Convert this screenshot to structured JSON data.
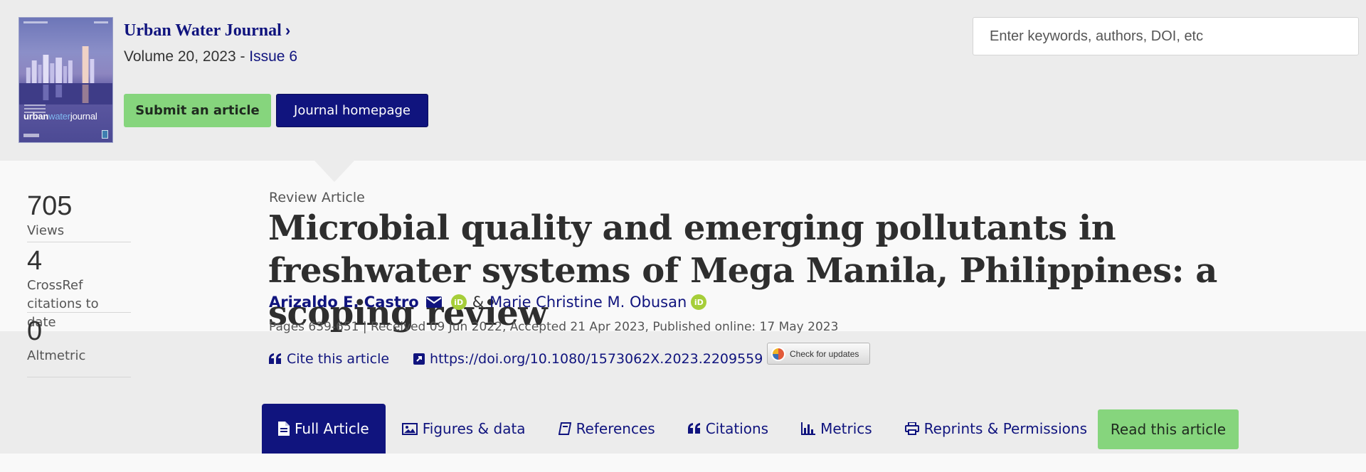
{
  "journal": {
    "cover_title_urban": "urban",
    "cover_title_water": "water",
    "cover_title_journal": "journal",
    "name": "Urban Water Journal",
    "chevron": "›",
    "volume_text": "Volume 20, 2023 - ",
    "issue_link": "Issue 6",
    "submit_label": "Submit an article",
    "homepage_label": "Journal homepage"
  },
  "search": {
    "placeholder": "Enter keywords, authors, DOI, etc"
  },
  "metrics": [
    {
      "value": "705",
      "label": "Views"
    },
    {
      "value": "4",
      "label_line1": "CrossRef",
      "label_line2": "citations to date"
    },
    {
      "value": "0",
      "label": "Altmetric"
    }
  ],
  "article": {
    "type": "Review Article",
    "title": "Microbial quality and emerging pollutants in freshwater systems of Mega Manila, Philippines: a scoping review",
    "author1": "Arizaldo E. Castro",
    "amp": "&",
    "author2": "Marie Christine M. Obusan",
    "orcid_label": "iD",
    "meta": "Pages 639-651 | Received 09 Jun 2022, Accepted 21 Apr 2023, Published online: 17 May 2023",
    "cite_label": "Cite this article",
    "doi": "https://doi.org/10.1080/1573062X.2023.2209559",
    "crossmark_label": "Check for updates"
  },
  "tabs": [
    {
      "label": "Full Article",
      "icon": "document-icon",
      "active": true
    },
    {
      "label": "Figures & data",
      "icon": "image-icon"
    },
    {
      "label": "References",
      "icon": "book-icon"
    },
    {
      "label": "Citations",
      "icon": "quote-icon"
    },
    {
      "label": "Metrics",
      "icon": "bar-chart-icon"
    },
    {
      "label": "Reprints & Permissions",
      "icon": "printer-icon"
    }
  ],
  "read_label": "Read this article",
  "colors": {
    "brand_navy": "#10147e",
    "accent_green": "#86d57d",
    "orcid_green": "#a6ce39",
    "band_grey": "#ececec",
    "panel_white": "#f9f9f9"
  }
}
